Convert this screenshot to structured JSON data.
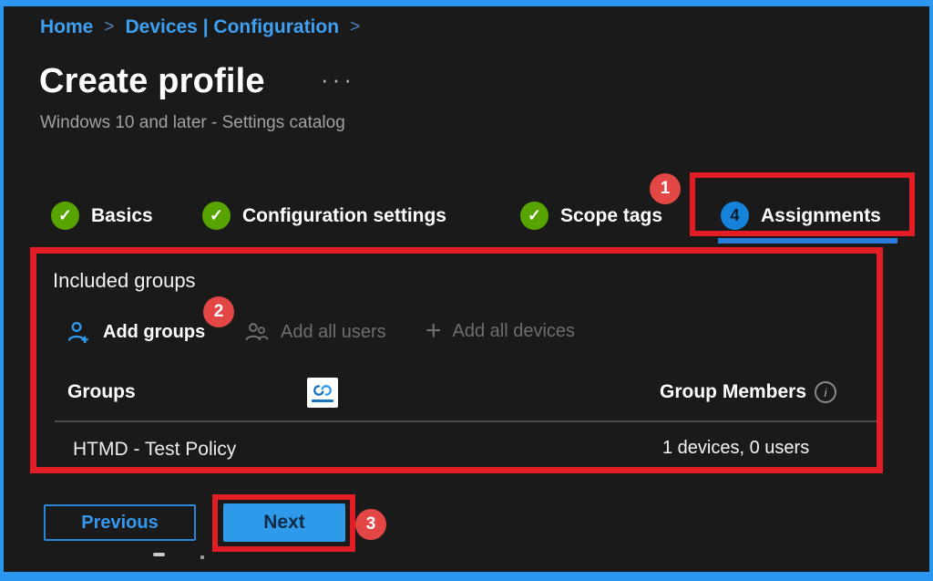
{
  "breadcrumb": {
    "home": "Home",
    "separator": ">",
    "devices_configuration": "Devices | Configuration"
  },
  "header": {
    "title": "Create profile",
    "subtitle": "Windows 10 and later - Settings catalog"
  },
  "icons": {
    "check": "✓",
    "info": "i",
    "ellipsis_menu": "···"
  },
  "tabs": [
    {
      "label": "Basics",
      "status": "complete"
    },
    {
      "label": "Configuration settings",
      "status": "complete"
    },
    {
      "label": "Scope tags",
      "status": "complete"
    },
    {
      "label": "Assignments",
      "status": "current",
      "step_number": "4"
    }
  ],
  "annotations": {
    "badge_1": "1",
    "badge_2": "2",
    "badge_3": "3"
  },
  "included_groups": {
    "heading": "Included groups",
    "toolbar": {
      "add_groups": "Add groups",
      "add_all_users": "Add all users",
      "add_all_devices": "Add all devices"
    },
    "table": {
      "col_groups": "Groups",
      "col_group_members": "Group Members",
      "rows": [
        {
          "group": "HTMD - Test Policy",
          "members": "1 devices, 0 users"
        }
      ]
    }
  },
  "footer": {
    "previous": "Previous",
    "next": "Next"
  },
  "colors": {
    "frame_border": "#2b97f0",
    "background": "#1a1a1a",
    "annotation_red": "#e21d25",
    "badge_red": "#e24745",
    "link_blue": "#3da0f2",
    "tab_green": "#57a300",
    "step_blue": "#1583d8",
    "tab_underline": "#2b7cd9",
    "next_button_blue": "#2e9ae9",
    "disabled_gray": "#6e6e6e"
  }
}
